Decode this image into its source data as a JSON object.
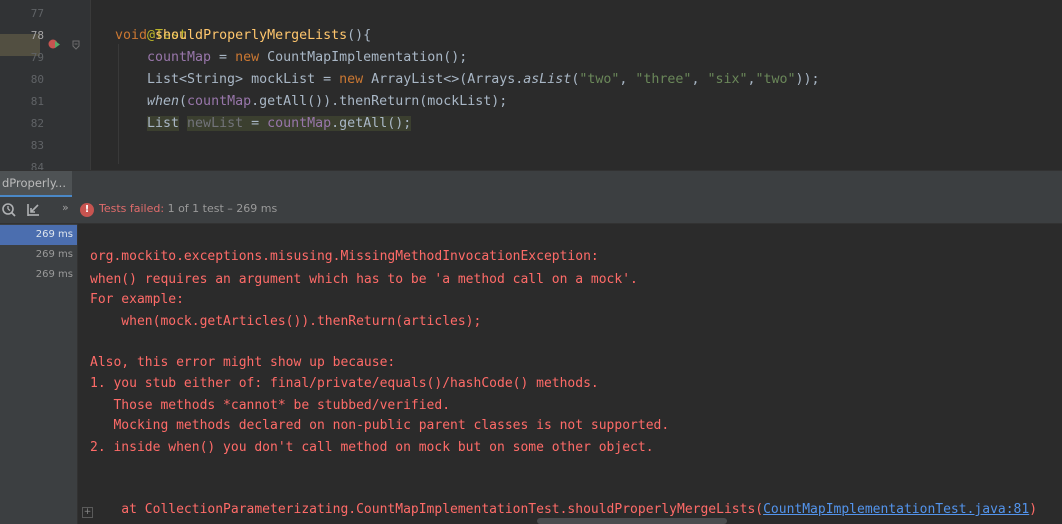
{
  "editor": {
    "line_numbers": [
      "77",
      "78",
      "79",
      "80",
      "81",
      "82",
      "83",
      "84"
    ],
    "lines": {
      "annotation": "@Test",
      "void_kw": "void ",
      "method_name": "shouldProperlyMergeLists",
      "method_tail": "(){",
      "l79_field": "countMap",
      "l79_eq": " = ",
      "l79_new": "new ",
      "l79_rest": "CountMapImplementation();",
      "l80_a": "List<String> mockList = ",
      "l80_new": "new ",
      "l80_b": "ArrayList<>(Arrays.",
      "l80_aslist": "asList",
      "l80_c": "(",
      "l80_s1": "\"two\"",
      "l80_sep1": ", ",
      "l80_s2": "\"three\"",
      "l80_sep2": ", ",
      "l80_s3": "\"six\"",
      "l80_sep3": ",",
      "l80_s4": "\"two\"",
      "l80_end": "));",
      "l81_when": "when",
      "l81_a": "(",
      "l81_field": "countMap",
      "l81_b": ".getAll()).thenReturn(mockList);",
      "l82_type": "List",
      "l82_sp": " ",
      "l82_var": "newList",
      "l82_eq": " = ",
      "l82_field": "countMap",
      "l82_rest": ".getAll();"
    }
  },
  "tool_window": {
    "tab_label": "dProperly..."
  },
  "toolbar": {
    "expand": "»",
    "error_glyph": "!",
    "status_failed": "Tests failed: ",
    "status_rest": "1 of 1 test – 269 ms"
  },
  "tree": {
    "rows": [
      "269 ms",
      "269 ms",
      "269 ms"
    ]
  },
  "console": {
    "lines": [
      "org.mockito.exceptions.misusing.MissingMethodInvocationException:",
      "when() requires an argument which has to be 'a method call on a mock'.",
      "For example:",
      "    when(mock.getArticles()).thenReturn(articles);",
      "",
      "Also, this error might show up because:",
      "1. you stub either of: final/private/equals()/hashCode() methods.",
      "   Those methods *cannot* be stubbed/verified.",
      "   Mocking methods declared on non-public parent classes is not supported.",
      "2. inside when() you don't call method on mock but on some other object."
    ],
    "stack_prefix": "    at CollectionParameterizating.CountMapImplementationTest.shouldProperlyMergeLists(",
    "stack_link": "CountMapImplementationTest.java:81",
    "stack_suffix": ")",
    "expand_glyph": "+"
  },
  "colors": {
    "error_text": "#ff6b68",
    "link": "#5394ec",
    "selection": "#4b6eaf"
  }
}
